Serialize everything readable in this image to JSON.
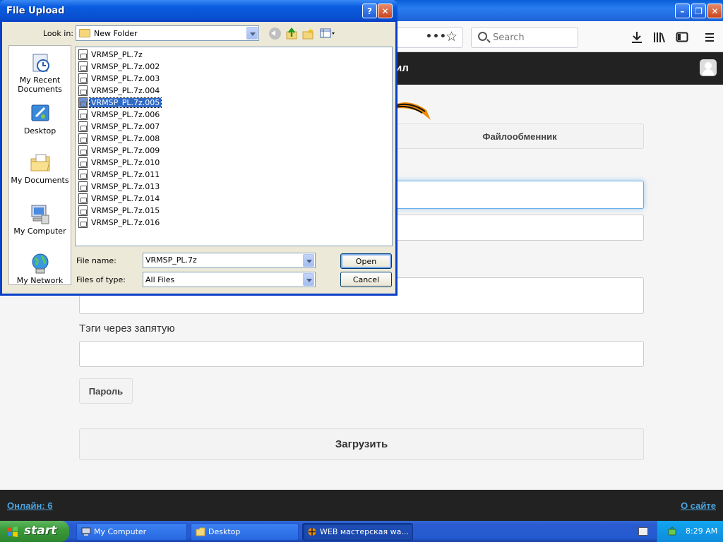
{
  "browser": {
    "search_placeholder": "Search",
    "url_more": "•••",
    "header_title_fragment": "ил"
  },
  "site": {
    "tab_fileshare": "Файлообменник",
    "tags_label": "Тэги через запятую",
    "password_button": "Пароль",
    "upload_button": "Загрузить",
    "footer_online": "Онлайн: 6",
    "footer_about": "О сайте"
  },
  "dialog": {
    "title": "File Upload",
    "help_label": "?",
    "close_label": "✕",
    "look_in_label": "Look in:",
    "look_in_value": "New Folder",
    "places": [
      {
        "label": "My Recent Documents",
        "icon": "recent-documents-icon"
      },
      {
        "label": "Desktop",
        "icon": "desktop-icon"
      },
      {
        "label": "My Documents",
        "icon": "my-documents-icon"
      },
      {
        "label": "My Computer",
        "icon": "my-computer-icon"
      },
      {
        "label": "My Network",
        "icon": "my-network-icon"
      }
    ],
    "files": [
      "VRMSP_PL.7z",
      "VRMSP_PL.7z.002",
      "VRMSP_PL.7z.003",
      "VRMSP_PL.7z.004",
      "VRMSP_PL.7z.005",
      "VRMSP_PL.7z.006",
      "VRMSP_PL.7z.007",
      "VRMSP_PL.7z.008",
      "VRMSP_PL.7z.009",
      "VRMSP_PL.7z.010",
      "VRMSP_PL.7z.011",
      "VRMSP_PL.7z.013",
      "VRMSP_PL.7z.014",
      "VRMSP_PL.7z.015",
      "VRMSP_PL.7z.016"
    ],
    "selected_file": "VRMSP_PL.7z.005",
    "file_name_label": "File name:",
    "file_name_value": "VRMSP_PL.7z",
    "files_of_type_label": "Files of type:",
    "files_of_type_value": "All Files",
    "open_label": "Open",
    "cancel_label": "Cancel"
  },
  "taskbar": {
    "start_label": "start",
    "tasks": [
      {
        "label": "My Computer",
        "icon": "computer-icon"
      },
      {
        "label": "Desktop",
        "icon": "folder-icon"
      },
      {
        "label": "WEB мастерская wa...",
        "icon": "browser-icon"
      }
    ],
    "clock": "8:29 AM"
  },
  "colors": {
    "xp_title_blue": "#0a5ce0",
    "selection_blue": "#316ac5",
    "site_dark": "#222222",
    "link_blue": "#4aa3df",
    "start_green": "#3c9a3c"
  }
}
